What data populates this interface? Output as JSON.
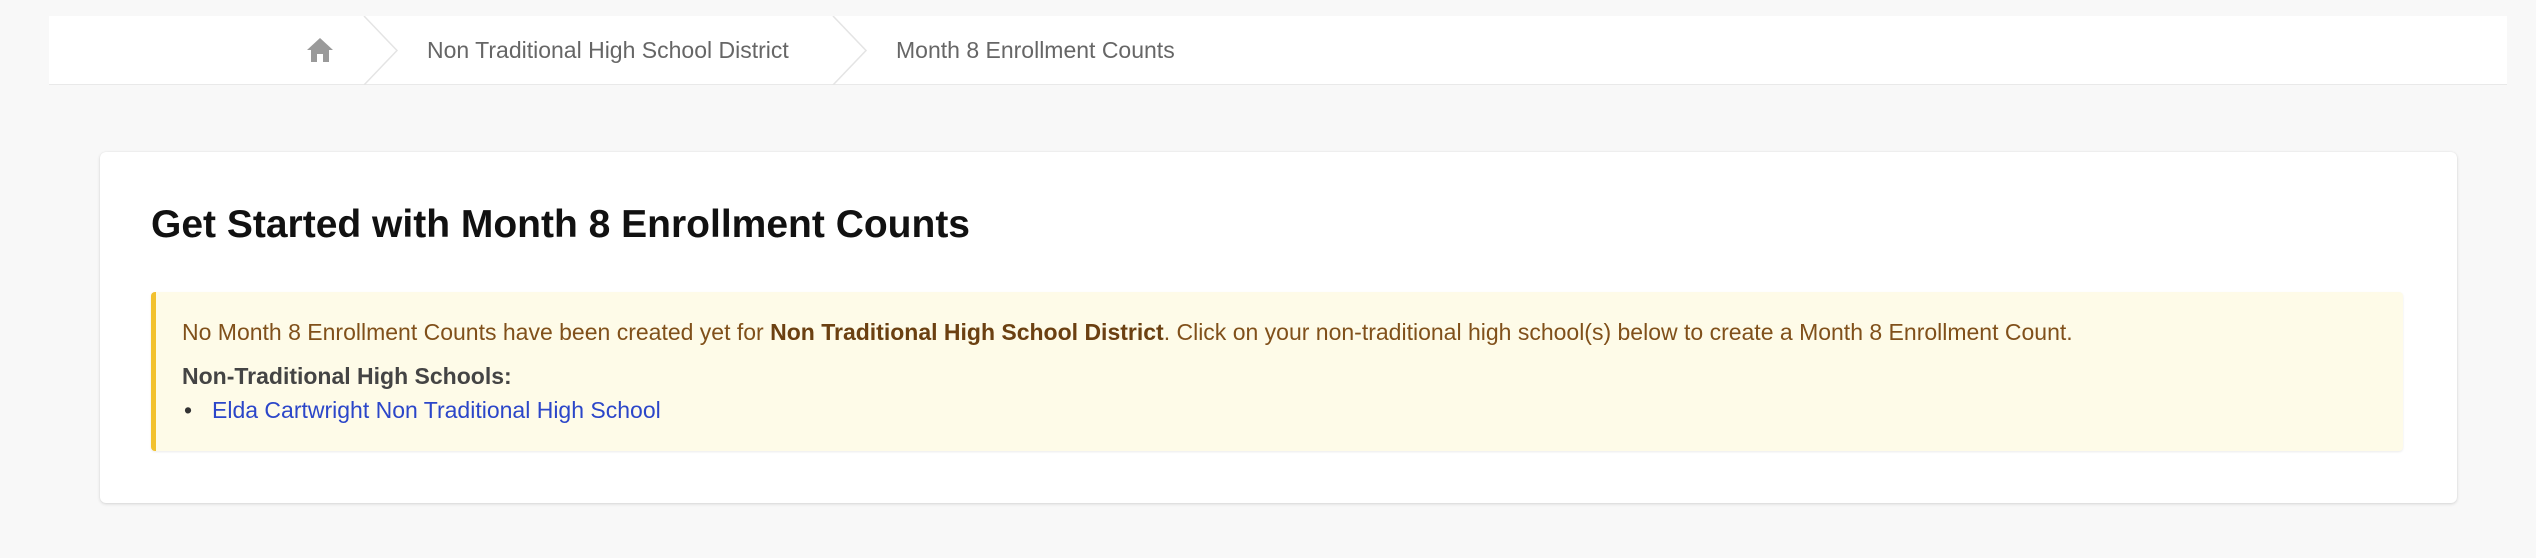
{
  "breadcrumb": {
    "home_icon": "home-icon",
    "items": [
      {
        "label": "Non Traditional High School District"
      },
      {
        "label": "Month 8 Enrollment Counts"
      }
    ]
  },
  "main": {
    "title": "Get Started with Month 8 Enrollment Counts",
    "notice": {
      "message_prefix": "No Month 8 Enrollment Counts have been created yet for ",
      "district_name": "Non Traditional High School District",
      "message_suffix": ". Click on your non-traditional high school(s) below to create a Month 8 Enrollment Count.",
      "schools_heading": "Non-Traditional High Schools:",
      "schools": [
        {
          "name": "Elda Cartwright Non Traditional High School"
        }
      ]
    }
  },
  "colors": {
    "page_background": "#f8f8f8",
    "notice_background": "#fefbe8",
    "notice_border": "#f2c12e",
    "notice_text": "#80501a",
    "link": "#2b46c9"
  }
}
